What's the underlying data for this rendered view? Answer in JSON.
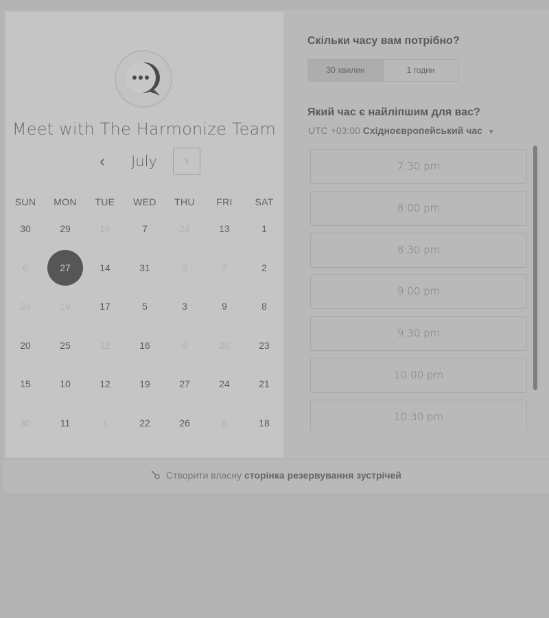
{
  "header": {
    "title": "Meet with The Harmonize Team"
  },
  "calendar": {
    "month": "July",
    "prev_icon": "‹",
    "next_icon": "›",
    "weekdays": [
      "SUN",
      "MON",
      "TUE",
      "WED",
      "THU",
      "FRI",
      "SAT"
    ],
    "weeks": [
      [
        {
          "d": "30",
          "m": false
        },
        {
          "d": "29",
          "m": false
        },
        {
          "d": "16",
          "m": true
        },
        {
          "d": "7",
          "m": false
        },
        {
          "d": "24",
          "m": true
        },
        {
          "d": "13",
          "m": false
        },
        {
          "d": "1",
          "m": false
        }
      ],
      [
        {
          "d": "6",
          "m": true
        },
        {
          "d": "27",
          "m": false,
          "sel": true
        },
        {
          "d": "14",
          "m": false
        },
        {
          "d": "31",
          "m": false
        },
        {
          "d": "9",
          "m": true
        },
        {
          "d": "7",
          "m": true
        },
        {
          "d": "2",
          "m": false
        }
      ],
      [
        {
          "d": "24",
          "m": true
        },
        {
          "d": "19",
          "m": true
        },
        {
          "d": "17",
          "m": false
        },
        {
          "d": "5",
          "m": false
        },
        {
          "d": "3",
          "m": false
        },
        {
          "d": "9",
          "m": false
        },
        {
          "d": "8",
          "m": false
        }
      ],
      [
        {
          "d": "20",
          "m": false
        },
        {
          "d": "25",
          "m": false
        },
        {
          "d": "11",
          "m": true
        },
        {
          "d": "16",
          "m": false
        },
        {
          "d": "9",
          "m": true
        },
        {
          "d": "20",
          "m": true
        },
        {
          "d": "23",
          "m": false
        }
      ],
      [
        {
          "d": "15",
          "m": false
        },
        {
          "d": "10",
          "m": false
        },
        {
          "d": "12",
          "m": false
        },
        {
          "d": "19",
          "m": false
        },
        {
          "d": "27",
          "m": false
        },
        {
          "d": "24",
          "m": false
        },
        {
          "d": "21",
          "m": false
        }
      ],
      [
        {
          "d": "30",
          "m": true
        },
        {
          "d": "11",
          "m": false
        },
        {
          "d": "1",
          "m": true
        },
        {
          "d": "22",
          "m": false
        },
        {
          "d": "26",
          "m": false
        },
        {
          "d": "6",
          "m": true
        },
        {
          "d": "18",
          "m": false
        }
      ]
    ]
  },
  "duration": {
    "question": "Скільки часу вам потрібно?",
    "options": [
      "30 хвилин",
      "1 годин"
    ],
    "selected": 0
  },
  "time": {
    "question": "Який час є найліпшим для вас?",
    "tz_offset": "UTC +03:00",
    "tz_name": "Східноєвропейський час",
    "slots": [
      "7:30 pm",
      "8:00 pm",
      "8:30 pm",
      "9:00 pm",
      "9:30 pm",
      "10:00 pm",
      "10:30 pm"
    ]
  },
  "footer": {
    "prefix": "Створити власну",
    "link": "сторінка резервування зустрічей"
  },
  "colors": {
    "selected_day": "#565656",
    "page_bg": "#b3b3b3"
  }
}
